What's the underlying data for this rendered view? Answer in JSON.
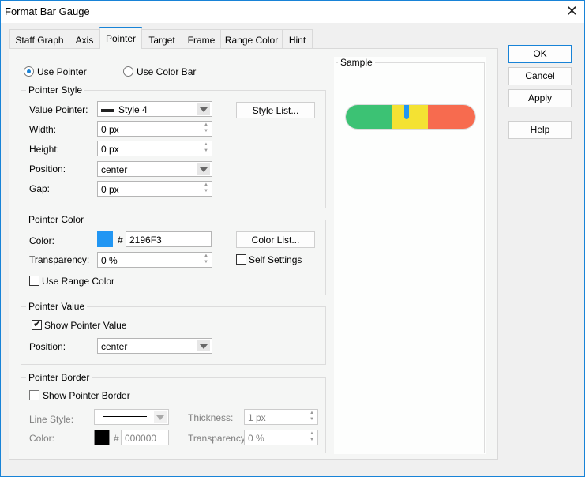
{
  "window": {
    "title": "Format Bar Gauge",
    "close_icon": "close-icon"
  },
  "tabs": [
    {
      "label": "Staff Graph"
    },
    {
      "label": "Axis"
    },
    {
      "label": "Pointer",
      "selected": true
    },
    {
      "label": "Target"
    },
    {
      "label": "Frame"
    },
    {
      "label": "Range Color"
    },
    {
      "label": "Hint"
    }
  ],
  "mode": {
    "use_pointer": "Use Pointer",
    "use_color_bar": "Use Color Bar",
    "selected": "Use Pointer"
  },
  "pointer_style": {
    "legend": "Pointer Style",
    "value_pointer_label": "Value Pointer:",
    "value_pointer": "Style 4",
    "style_list": "Style List...",
    "width_label": "Width:",
    "width": "0 px",
    "height_label": "Height:",
    "height": "0 px",
    "position_label": "Position:",
    "position": "center",
    "gap_label": "Gap:",
    "gap": "0 px"
  },
  "pointer_color": {
    "legend": "Pointer Color",
    "color_label": "Color:",
    "hash": "#",
    "color": "2196F3",
    "color_hex": "#2196F3",
    "color_list": "Color List...",
    "transparency_label": "Transparency:",
    "transparency": "0 %",
    "self_settings": "Self Settings",
    "self_settings_checked": false,
    "use_range_color": "Use Range Color",
    "use_range_color_checked": false
  },
  "pointer_value": {
    "legend": "Pointer Value",
    "show": "Show Pointer Value",
    "show_checked": true,
    "position_label": "Position:",
    "position": "center"
  },
  "pointer_border": {
    "legend": "Pointer Border",
    "show": "Show Pointer Border",
    "show_checked": false,
    "line_style_label": "Line Style:",
    "thickness_label": "Thickness:",
    "thickness": "1 px",
    "color_label": "Color:",
    "hash": "#",
    "color": "000000",
    "color_hex": "#000000",
    "transparency_label": "Transparency:",
    "transparency": "0 %"
  },
  "sample": {
    "legend": "Sample",
    "range_colors": [
      "#3CC274",
      "#F4E233",
      "#F76B4F"
    ],
    "pointer_color": "#2196F3"
  },
  "buttons": {
    "ok": "OK",
    "cancel": "Cancel",
    "apply": "Apply",
    "help": "Help"
  }
}
